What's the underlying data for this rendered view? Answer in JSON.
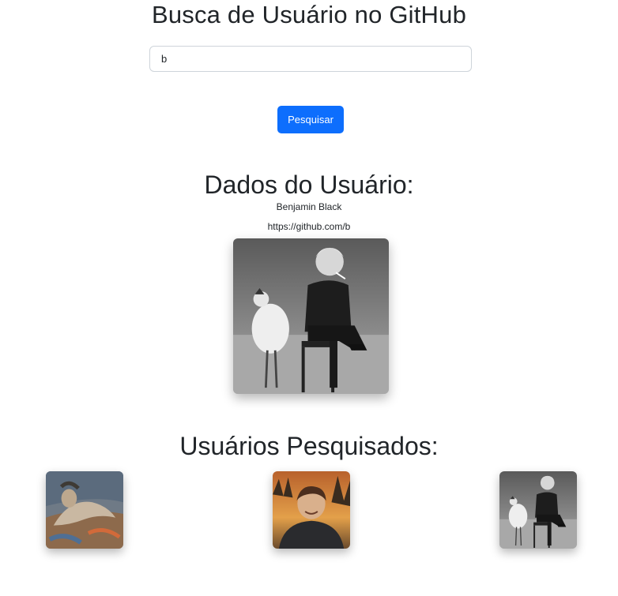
{
  "header": {
    "title": "Busca de Usuário no GitHub"
  },
  "search": {
    "value": "b",
    "button_label": "Pesquisar"
  },
  "user": {
    "section_title": "Dados do Usuário:",
    "name": "Benjamin Black",
    "url": "https://github.com/b",
    "avatar_icon": "avatar-boy-with-chicken"
  },
  "searched": {
    "section_title": "Usuários Pesquisados:",
    "items": [
      {
        "avatar_icon": "avatar-painting-figure"
      },
      {
        "avatar_icon": "avatar-smiling-person"
      },
      {
        "avatar_icon": "avatar-boy-with-chicken"
      }
    ]
  },
  "colors": {
    "primary": "#0d6efd",
    "text": "#212529",
    "input_border": "#ced4da"
  }
}
